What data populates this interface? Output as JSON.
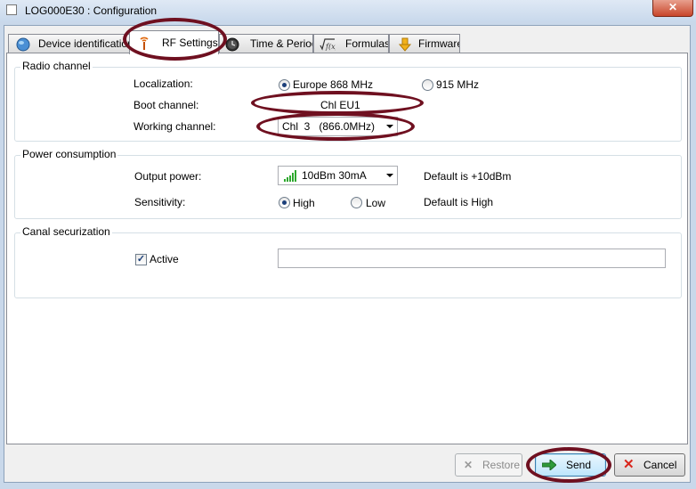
{
  "window": {
    "title": "LOG000E30 : Configuration",
    "close_glyph": "✕"
  },
  "tabs": [
    {
      "label": "Device identification",
      "icon": "globe-icon"
    },
    {
      "label": "RF Settings",
      "icon": "antenna-icon"
    },
    {
      "label": "Time & Period",
      "icon": "clock-icon"
    },
    {
      "label": "Formulas",
      "icon": "formula-icon"
    },
    {
      "label": "Firmware",
      "icon": "download-arrow-icon"
    }
  ],
  "radio_channel": {
    "group_title": "Radio channel",
    "localization_label": "Localization:",
    "option_europe": "Europe 868 MHz",
    "option_915": "915 MHz",
    "selected": "Europe 868 MHz",
    "boot_channel_label": "Boot channel:",
    "boot_channel_value": "Chl EU1",
    "working_channel_label": "Working channel:",
    "working_channel_value": "Chl  3   (866.0MHz)"
  },
  "power_consumption": {
    "group_title": "Power consumption",
    "output_power_label": "Output power:",
    "output_power_value": "10dBm 30mA",
    "output_power_default": "Default is +10dBm",
    "sensitivity_label": "Sensitivity:",
    "option_high": "High",
    "option_low": "Low",
    "selected": "High",
    "sensitivity_default": "Default is High"
  },
  "canal_securization": {
    "group_title": "Canal securization",
    "active_label": "Active",
    "active_checked": true,
    "key_value": ""
  },
  "buttons": {
    "restore": "Restore",
    "send": "Send",
    "cancel": "Cancel"
  },
  "colors": {
    "highlight": "#6f1020",
    "signal_green": "#2ea82e",
    "cancel_red": "#d9261c",
    "send_green": "#2e9b3a"
  }
}
